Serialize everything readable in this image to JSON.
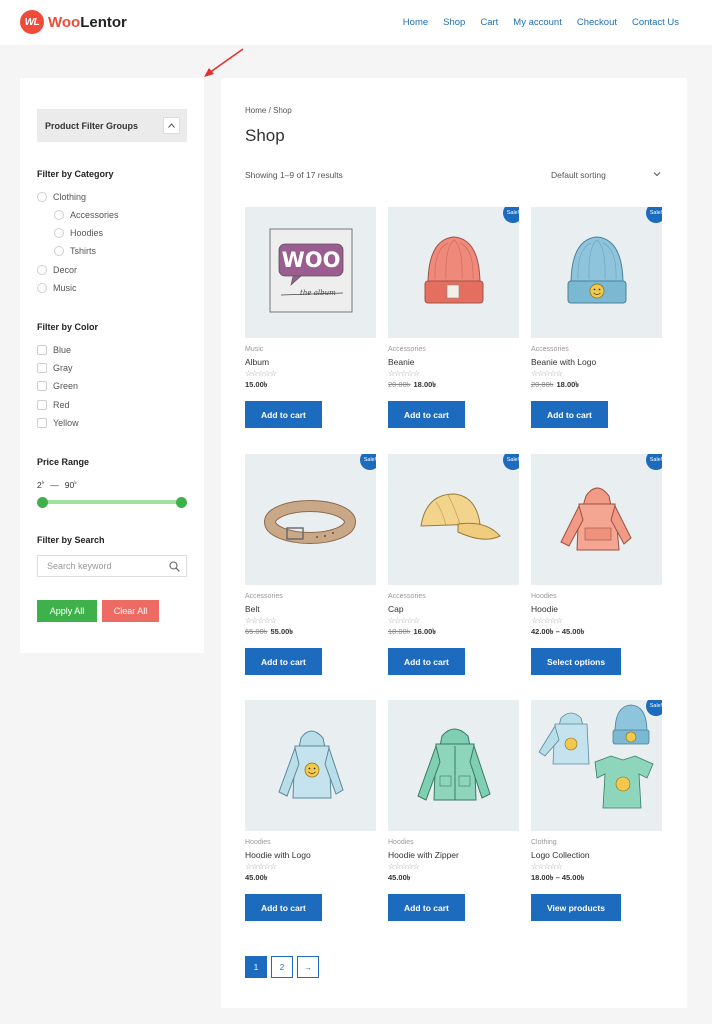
{
  "header": {
    "logo_badge": "WL",
    "logo_woo": "Woo",
    "logo_rest": "Lentor",
    "nav": [
      "Home",
      "Shop",
      "Cart",
      "My account",
      "Checkout",
      "Contact Us"
    ]
  },
  "sidebar": {
    "group_title": "Product Filter Groups",
    "category_title": "Filter by Category",
    "categories": [
      "Clothing",
      "Accessories",
      "Hoodies",
      "Tshirts",
      "Decor",
      "Music"
    ],
    "color_title": "Filter by Color",
    "colors": [
      "Blue",
      "Gray",
      "Green",
      "Red",
      "Yellow"
    ],
    "price_title": "Price Range",
    "price_min": "2",
    "price_sep": "—",
    "price_max": "90",
    "currency": "৳",
    "search_title": "Filter by Search",
    "search_placeholder": "Search keyword",
    "apply": "Apply All",
    "clear": "Clear All"
  },
  "main": {
    "breadcrumb": "Home / Shop",
    "title": "Shop",
    "showing": "Showing 1–9 of 17 results",
    "sorting": "Default sorting",
    "sale_label": "Sale!",
    "products": [
      {
        "cat": "Music",
        "name": "Album",
        "stars": "☆☆☆☆☆",
        "old": "",
        "price": "15.00৳",
        "button": "Add to cart",
        "sale": false
      },
      {
        "cat": "Accessories",
        "name": "Beanie",
        "stars": "☆☆☆☆☆",
        "old": "20.00৳",
        "price": "18.00৳",
        "button": "Add to cart",
        "sale": true
      },
      {
        "cat": "Accessories",
        "name": "Beanie with Logo",
        "stars": "☆☆☆☆☆",
        "old": "20.00৳",
        "price": "18.00৳",
        "button": "Add to cart",
        "sale": true
      },
      {
        "cat": "Accessories",
        "name": "Belt",
        "stars": "☆☆☆☆☆",
        "old": "65.00৳",
        "price": "55.00৳",
        "button": "Add to cart",
        "sale": true
      },
      {
        "cat": "Accessories",
        "name": "Cap",
        "stars": "☆☆☆☆☆",
        "old": "18.00৳",
        "price": "16.00৳",
        "button": "Add to cart",
        "sale": true
      },
      {
        "cat": "Hoodies",
        "name": "Hoodie",
        "stars": "☆☆☆☆☆",
        "old": "",
        "price": "42.00৳ – 45.00৳",
        "button": "Select options",
        "sale": true
      },
      {
        "cat": "Hoodies",
        "name": "Hoodie with Logo",
        "stars": "☆☆☆☆☆",
        "old": "",
        "price": "45.00৳",
        "button": "Add to cart",
        "sale": false
      },
      {
        "cat": "Hoodies",
        "name": "Hoodie with Zipper",
        "stars": "☆☆☆☆☆",
        "old": "",
        "price": "45.00৳",
        "button": "Add to cart",
        "sale": false
      },
      {
        "cat": "Clothing",
        "name": "Logo Collection",
        "stars": "☆☆☆☆☆",
        "old": "",
        "price": "18.00৳ – 45.00৳",
        "button": "View products",
        "sale": true
      }
    ],
    "pagination": [
      "1",
      "2",
      "→"
    ]
  },
  "colors": {
    "accent": "#1d6bbf",
    "apply": "#3fb14a",
    "clear": "#ee6b63",
    "logo": "#ee4b3b"
  }
}
